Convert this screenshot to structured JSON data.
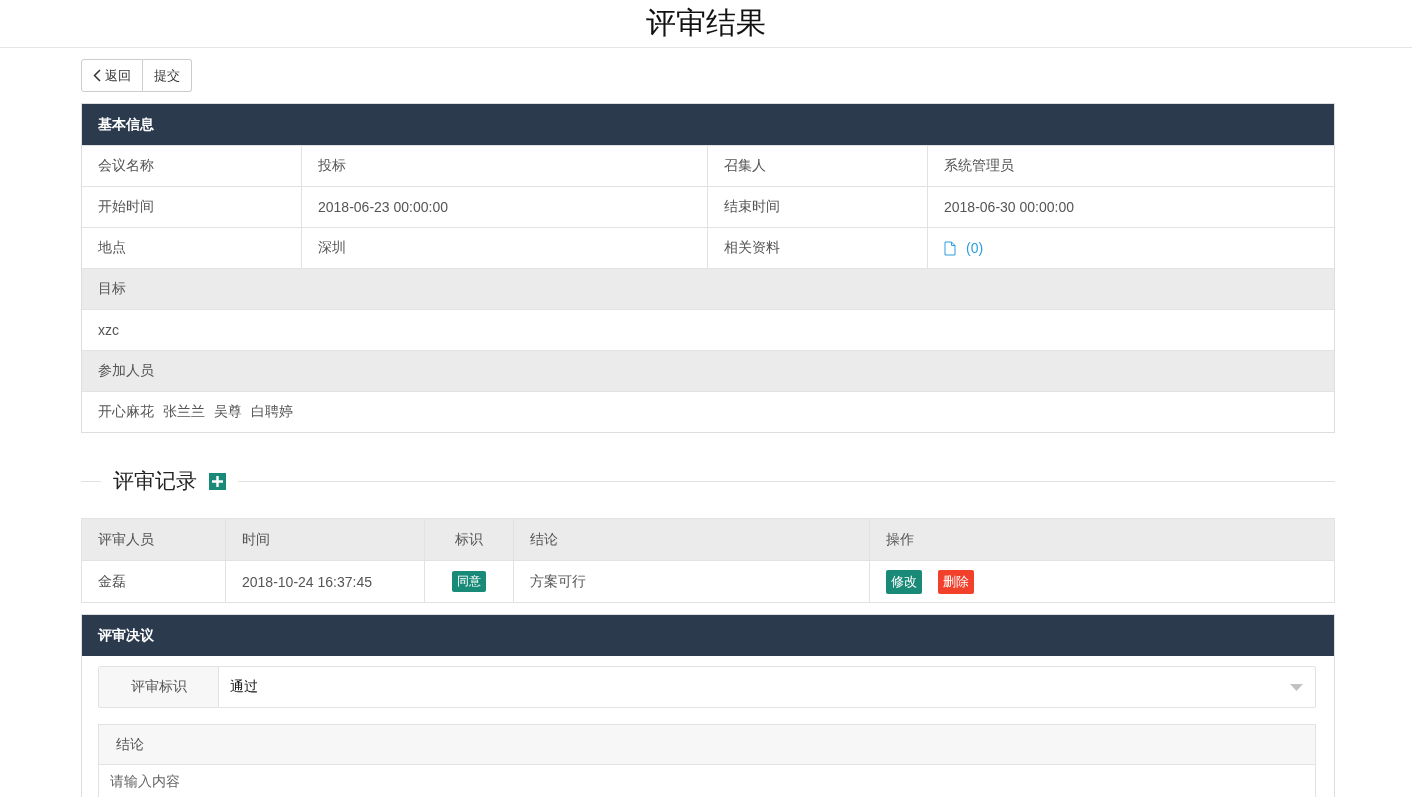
{
  "page": {
    "title": "评审结果"
  },
  "toolbar": [
    {
      "label": "返回",
      "kind": "back"
    },
    {
      "label": "提交",
      "kind": "plain"
    }
  ],
  "basic_info": {
    "title": "基本信息",
    "fields": [
      {
        "label": "会议名称",
        "value": "投标",
        "kind": "text"
      },
      {
        "label": "召集人",
        "value": "系统管理员",
        "kind": "text"
      },
      {
        "label": "开始时间",
        "value": "2018-06-23 00:00:00",
        "kind": "text"
      },
      {
        "label": "结束时间",
        "value": "2018-06-30 00:00:00",
        "kind": "text"
      },
      {
        "label": "地点",
        "value": "深圳",
        "kind": "text"
      },
      {
        "label": "相关资料",
        "value": "(0)",
        "kind": "file-link"
      }
    ],
    "sections": [
      {
        "label": "目标",
        "values": [
          "xzc"
        ]
      },
      {
        "label": "参加人员",
        "values": [
          "开心麻花",
          "张兰兰",
          "吴尊",
          "白聘婷"
        ]
      }
    ]
  },
  "records": {
    "title": "评审记录",
    "columns": [
      "评审人员",
      "时间",
      "标识",
      "结论",
      "操作"
    ],
    "rows": [
      {
        "reviewer": "金磊",
        "time": "2018-10-24 16:37:45",
        "tag": {
          "label": "同意",
          "color": "#1a8a78"
        },
        "conclusion": "方案可行",
        "actions": [
          {
            "label": "修改",
            "color": "#1a8a78"
          },
          {
            "label": "删除",
            "color": "#f2402a"
          }
        ]
      }
    ]
  },
  "decision": {
    "title": "评审决议",
    "select": {
      "label": "评审标识",
      "value": "通过"
    },
    "conclusion": {
      "label": "结论",
      "placeholder": "请输入内容"
    }
  }
}
